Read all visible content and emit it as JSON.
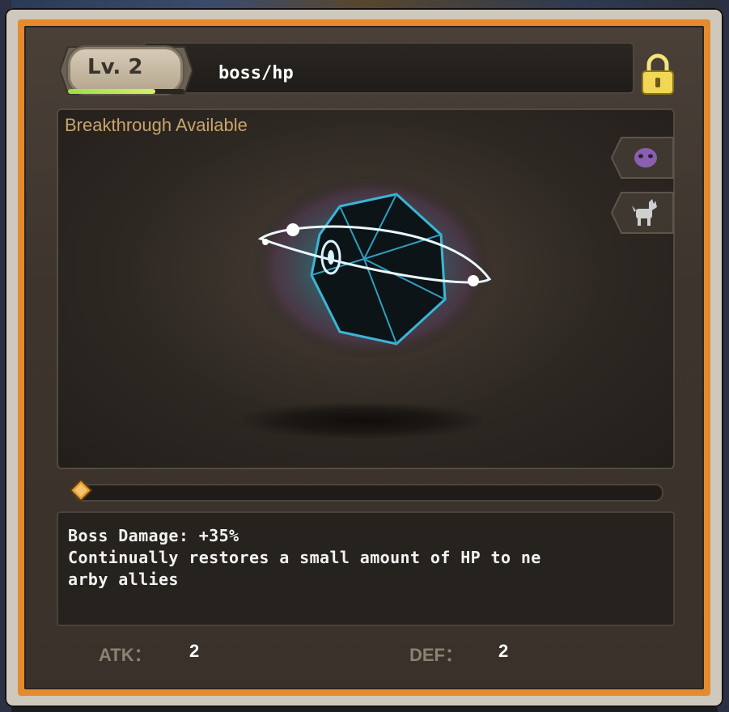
{
  "item": {
    "level_label": "Lv. 2",
    "level_progress": 0.75,
    "name": "boss/hp",
    "locked": true,
    "status_text": "Breakthrough Available",
    "icon": "orbital-crystal-gem"
  },
  "side_buttons": [
    {
      "icon": "purple-mask-icon"
    },
    {
      "icon": "pet-dog-icon"
    }
  ],
  "enhance": {
    "progress": 0.0
  },
  "description": {
    "lines": [
      "Boss Damage: +35%",
      "Continually restores a small amount of HP to ne",
      "arby allies"
    ]
  },
  "stats": {
    "atk_label": "ATK：",
    "atk_value": "2",
    "def_label": "DEF：",
    "def_value": "2"
  },
  "colors": {
    "frame_orange": "#e58a2e",
    "status_gold": "#c9a46b",
    "level_bar_green": "#9be04a"
  }
}
